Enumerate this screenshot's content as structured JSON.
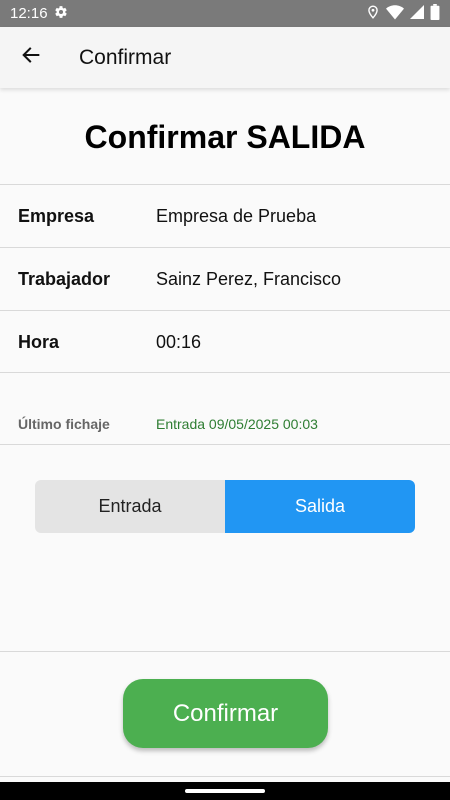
{
  "status_bar": {
    "time": "12:16"
  },
  "app_bar": {
    "title": "Confirmar"
  },
  "heading": "Confirmar SALIDA",
  "details": [
    {
      "label": "Empresa",
      "value": "Empresa de Prueba"
    },
    {
      "label": "Trabajador",
      "value": "Sainz Perez, Francisco"
    },
    {
      "label": "Hora",
      "value": "00:16"
    }
  ],
  "last_record": {
    "label": "Último fichaje",
    "value": "Entrada 09/05/2025 00:03"
  },
  "toggle": {
    "options": [
      "Entrada",
      "Salida"
    ],
    "selected": "Salida"
  },
  "confirm_button": "Confirmar",
  "colors": {
    "selected_segment": "#2196f3",
    "confirm": "#4caf50",
    "last_record_value": "#2e7d32"
  }
}
